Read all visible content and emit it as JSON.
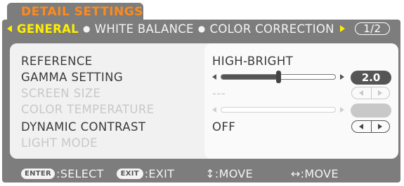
{
  "window": {
    "title": "DETAIL SETTINGS"
  },
  "tabs": {
    "items": [
      "GENERAL",
      "WHITE BALANCE",
      "COLOR CORRECTION"
    ],
    "active": "GENERAL",
    "page": "1/2"
  },
  "rows": [
    {
      "label": "REFERENCE",
      "value": "HIGH-BRIGHT",
      "enabled": true
    },
    {
      "label": "GAMMA SETTING",
      "value": "2.0",
      "level": 0.5,
      "enabled": true
    },
    {
      "label": "SCREEN SIZE",
      "value": "---",
      "enabled": false
    },
    {
      "label": "COLOR TEMPERATURE",
      "value": "",
      "enabled": false
    },
    {
      "label": "DYNAMIC CONTRAST",
      "value": "OFF",
      "enabled": true
    },
    {
      "label": "LIGHT MODE",
      "value": "",
      "enabled": false
    }
  ],
  "footer": {
    "enter_key": "ENTER",
    "enter_hint": ":SELECT",
    "exit_key": "EXIT",
    "exit_hint": ":EXIT",
    "move_updown": "↕:MOVE",
    "move_leftright": "↔:MOVE"
  },
  "colors": {
    "frame": "#7d7d7d",
    "title_text": "#ff8a1c",
    "active_tab": "#ffee00",
    "panel": "#f1f1f1",
    "text_active": "#3a3a3a",
    "text_disabled": "#c8c8c8"
  }
}
